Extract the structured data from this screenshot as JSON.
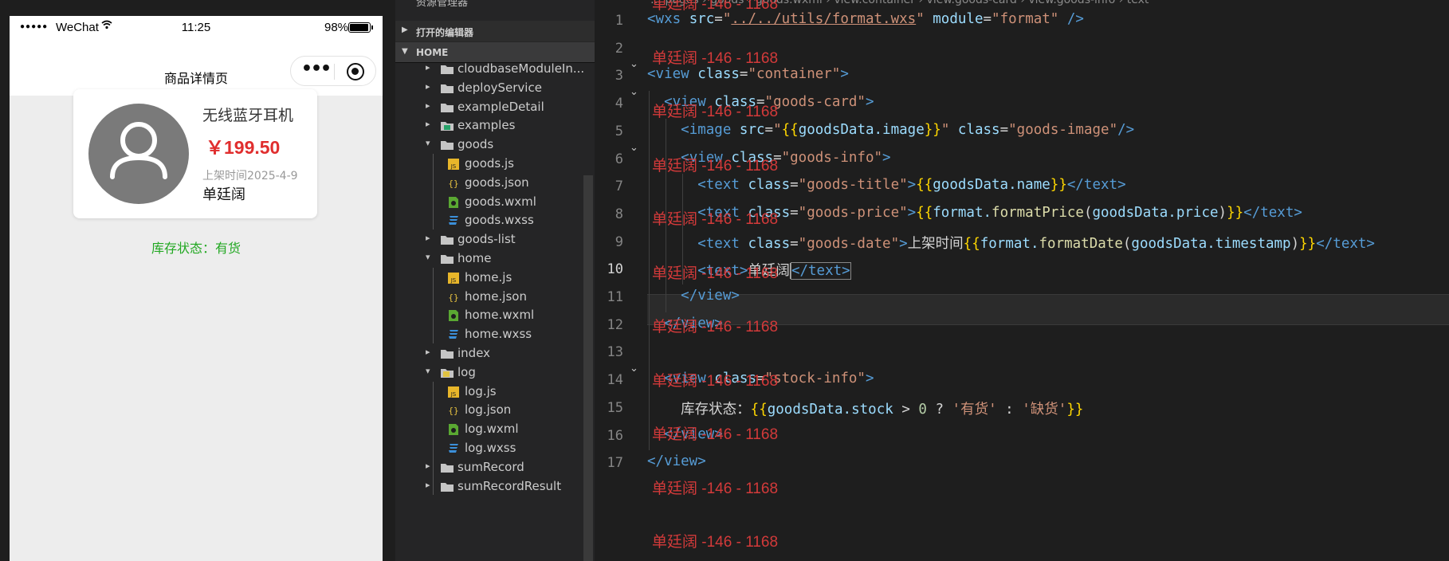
{
  "phone": {
    "signal": "●●●●●",
    "carrier": "WeChat",
    "time": "11:25",
    "battery_pct": "98%",
    "battery_level": 0.98,
    "nav_title": "商品详情页",
    "more_icon": "•••",
    "card": {
      "title": "无线蓝牙耳机",
      "price": "￥199.50",
      "date": "上架时间2025-4-9",
      "name": "单廷阔"
    },
    "stock_text": "库存状态：有货",
    "colors": {
      "price": "#e02e2e",
      "stock": "#22a822"
    }
  },
  "explorer": {
    "header_title": "资源管理器",
    "header_dots": "···",
    "section_open": "打开的编辑器",
    "section_home": "HOME",
    "rows": [
      {
        "name": "cloudbaseModuleIn...",
        "type": "folder",
        "open": false,
        "depth": 1
      },
      {
        "name": "deployService",
        "type": "folder",
        "open": false,
        "depth": 1
      },
      {
        "name": "exampleDetail",
        "type": "folder",
        "open": false,
        "depth": 1
      },
      {
        "name": "examples",
        "type": "folder-special",
        "open": false,
        "depth": 1
      },
      {
        "name": "goods",
        "type": "folder",
        "open": true,
        "depth": 1
      },
      {
        "name": "goods.js",
        "type": "js",
        "depth": 2
      },
      {
        "name": "goods.json",
        "type": "json",
        "depth": 2
      },
      {
        "name": "goods.wxml",
        "type": "wxml",
        "depth": 2
      },
      {
        "name": "goods.wxss",
        "type": "wxss",
        "depth": 2
      },
      {
        "name": "goods-list",
        "type": "folder",
        "open": false,
        "depth": 1
      },
      {
        "name": "home",
        "type": "folder",
        "open": true,
        "depth": 1
      },
      {
        "name": "home.js",
        "type": "js",
        "depth": 2
      },
      {
        "name": "home.json",
        "type": "json",
        "depth": 2
      },
      {
        "name": "home.wxml",
        "type": "wxml",
        "depth": 2
      },
      {
        "name": "home.wxss",
        "type": "wxss",
        "depth": 2
      },
      {
        "name": "index",
        "type": "folder",
        "open": false,
        "depth": 1
      },
      {
        "name": "log",
        "type": "folder-log",
        "open": true,
        "depth": 1
      },
      {
        "name": "log.js",
        "type": "js",
        "depth": 2
      },
      {
        "name": "log.json",
        "type": "json",
        "depth": 2
      },
      {
        "name": "log.wxml",
        "type": "wxml",
        "depth": 2
      },
      {
        "name": "log.wxss",
        "type": "wxss",
        "depth": 2
      },
      {
        "name": "sumRecord",
        "type": "folder",
        "open": false,
        "depth": 1
      },
      {
        "name": "sumRecordResult",
        "type": "folder",
        "open": false,
        "depth": 1
      }
    ]
  },
  "editor": {
    "breadcrumb": "…  pages › goods › goods.wxml › view.container › view.goods-card › view.goods-info › text",
    "watermark": "单廷阔 -146 - 1168",
    "current_line": 10,
    "lines": [
      {
        "n": 1,
        "fold": false,
        "tokens": [
          [
            "t",
            "<wxs "
          ],
          [
            "a",
            "src"
          ],
          [
            "o",
            "="
          ],
          [
            "s",
            "\""
          ],
          [
            "s ul",
            "../../utils/format.wxs"
          ],
          [
            "s",
            "\""
          ],
          [
            "a",
            " module"
          ],
          [
            "o",
            "="
          ],
          [
            "s",
            "\"format\""
          ],
          [
            "t",
            " />"
          ]
        ]
      },
      {
        "n": 2,
        "fold": false,
        "tokens": []
      },
      {
        "n": 3,
        "fold": true,
        "tokens": [
          [
            "t",
            "<view "
          ],
          [
            "a",
            "class"
          ],
          [
            "o",
            "="
          ],
          [
            "s",
            "\"container\""
          ],
          [
            "t",
            ">"
          ]
        ]
      },
      {
        "n": 4,
        "fold": true,
        "tokens": [
          [
            "p",
            "  "
          ],
          [
            "t",
            "<view "
          ],
          [
            "a",
            "class"
          ],
          [
            "o",
            "="
          ],
          [
            "s",
            "\"goods-card\""
          ],
          [
            "t",
            ">"
          ]
        ]
      },
      {
        "n": 5,
        "fold": false,
        "tokens": [
          [
            "p",
            "    "
          ],
          [
            "t",
            "<image "
          ],
          [
            "a",
            "src"
          ],
          [
            "o",
            "="
          ],
          [
            "s",
            "\""
          ],
          [
            "b",
            "{{"
          ],
          [
            "a",
            "goodsData.image"
          ],
          [
            "b",
            "}}"
          ],
          [
            "s",
            "\""
          ],
          [
            "a",
            " class"
          ],
          [
            "o",
            "="
          ],
          [
            "s",
            "\"goods-image\""
          ],
          [
            "t",
            "/>"
          ]
        ]
      },
      {
        "n": 6,
        "fold": true,
        "tokens": [
          [
            "p",
            "    "
          ],
          [
            "t",
            "<view "
          ],
          [
            "a",
            "class"
          ],
          [
            "o",
            "="
          ],
          [
            "s",
            "\"goods-info\""
          ],
          [
            "t",
            ">"
          ]
        ]
      },
      {
        "n": 7,
        "fold": false,
        "tokens": [
          [
            "p",
            "      "
          ],
          [
            "t",
            "<text "
          ],
          [
            "a",
            "class"
          ],
          [
            "o",
            "="
          ],
          [
            "s",
            "\"goods-title\""
          ],
          [
            "t",
            ">"
          ],
          [
            "b",
            "{{"
          ],
          [
            "a",
            "goodsData.name"
          ],
          [
            "b",
            "}}"
          ],
          [
            "t",
            "</text>"
          ]
        ]
      },
      {
        "n": 8,
        "fold": false,
        "tokens": [
          [
            "p",
            "      "
          ],
          [
            "t",
            "<text "
          ],
          [
            "a",
            "class"
          ],
          [
            "o",
            "="
          ],
          [
            "s",
            "\"goods-price\""
          ],
          [
            "t",
            ">"
          ],
          [
            "b",
            "{{"
          ],
          [
            "a",
            "format."
          ],
          [
            "f",
            "formatPrice"
          ],
          [
            "p",
            "("
          ],
          [
            "a",
            "goodsData.price"
          ],
          [
            "p",
            ")"
          ],
          [
            "b",
            "}}"
          ],
          [
            "t",
            "</text>"
          ]
        ]
      },
      {
        "n": 9,
        "fold": false,
        "tokens": [
          [
            "p",
            "      "
          ],
          [
            "t",
            "<text "
          ],
          [
            "a",
            "class"
          ],
          [
            "o",
            "="
          ],
          [
            "s",
            "\"goods-date\""
          ],
          [
            "t",
            ">"
          ],
          [
            "p",
            "上架时间"
          ],
          [
            "b",
            "{{"
          ],
          [
            "a",
            "format."
          ],
          [
            "f",
            "formatDate"
          ],
          [
            "p",
            "("
          ],
          [
            "a",
            "goodsData.timestamp"
          ],
          [
            "p",
            ")"
          ],
          [
            "b",
            "}}"
          ],
          [
            "t",
            "</text>"
          ]
        ]
      },
      {
        "n": 10,
        "fold": false,
        "tokens": [
          [
            "p",
            "      "
          ],
          [
            "t",
            "<text>"
          ],
          [
            "p",
            "单廷阔"
          ],
          [
            "cursor",
            ""
          ],
          [
            "t bx",
            "</text>"
          ]
        ]
      },
      {
        "n": 11,
        "fold": false,
        "tokens": [
          [
            "p",
            "    "
          ],
          [
            "t",
            "</view>"
          ]
        ]
      },
      {
        "n": 12,
        "fold": false,
        "tokens": [
          [
            "p",
            "  "
          ],
          [
            "t",
            "</view>"
          ]
        ]
      },
      {
        "n": 13,
        "fold": false,
        "tokens": []
      },
      {
        "n": 14,
        "fold": true,
        "tokens": [
          [
            "p",
            "  "
          ],
          [
            "t",
            "<view "
          ],
          [
            "a",
            "class"
          ],
          [
            "o",
            "="
          ],
          [
            "s",
            "\"stock-info\""
          ],
          [
            "t",
            ">"
          ]
        ]
      },
      {
        "n": 15,
        "fold": false,
        "tokens": [
          [
            "p",
            "    库存状态："
          ],
          [
            "b",
            "{{"
          ],
          [
            "a",
            "goodsData.stock"
          ],
          [
            "o",
            " > "
          ],
          [
            "n",
            "0"
          ],
          [
            "o",
            " ? "
          ],
          [
            "s",
            "'有货'"
          ],
          [
            "o",
            " : "
          ],
          [
            "s",
            "'缺货'"
          ],
          [
            "b",
            "}}"
          ]
        ]
      },
      {
        "n": 16,
        "fold": false,
        "tokens": [
          [
            "p",
            "  "
          ],
          [
            "t",
            "</view>"
          ]
        ]
      },
      {
        "n": 17,
        "fold": false,
        "tokens": [
          [
            "t",
            "</view>"
          ]
        ]
      }
    ]
  }
}
